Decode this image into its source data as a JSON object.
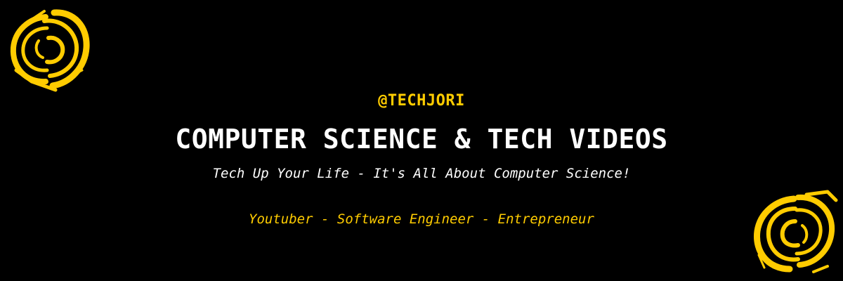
{
  "banner": {
    "handle": "@TECHJORI",
    "title": "COMPUTER SCIENCE & TECH VIDEOS",
    "tagline": "Tech Up Your Life - It's All About Computer Science!",
    "roles": "Youtuber - Software Engineer - Entrepreneur"
  },
  "decorations": {
    "top_left_icon": "swirl-brush-icon",
    "bottom_right_icon": "swirl-brush-icon"
  },
  "colors": {
    "background": "#000000",
    "accent": "#FFCC00",
    "text": "#FFFFFF"
  }
}
